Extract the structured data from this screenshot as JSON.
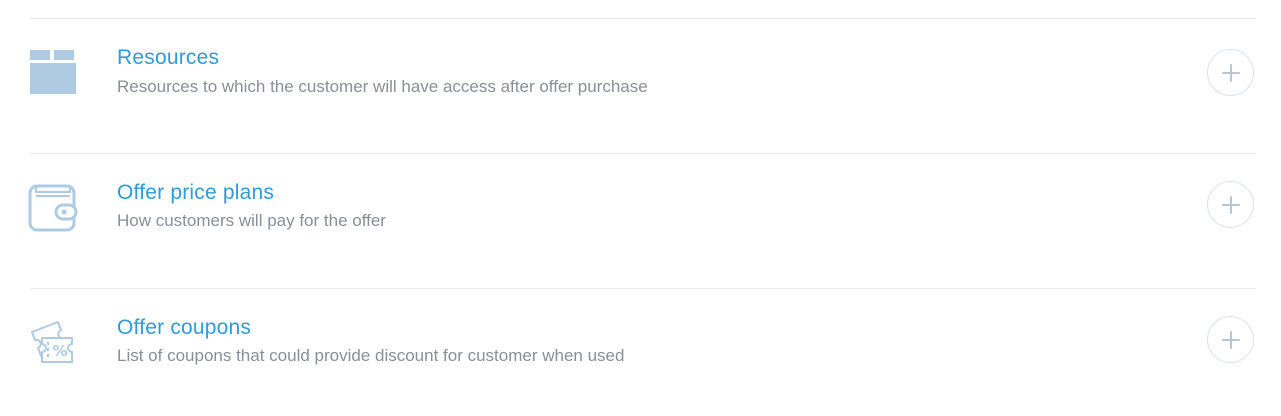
{
  "sections": [
    {
      "title": "Resources",
      "description": "Resources to which the customer will have access after offer purchase",
      "icon": "box-icon"
    },
    {
      "title": "Offer price plans",
      "description": "How customers will pay for the offer",
      "icon": "wallet-icon"
    },
    {
      "title": "Offer coupons",
      "description": "List of coupons that could provide discount for customer when used",
      "icon": "coupon-icon"
    }
  ],
  "colors": {
    "title": "#2f9bd9",
    "description": "#8a8f96",
    "icon": "#aecbe3",
    "divider": "#e8ebef",
    "add_button_border": "#dde2e8",
    "plus": "#b7c6d6"
  }
}
